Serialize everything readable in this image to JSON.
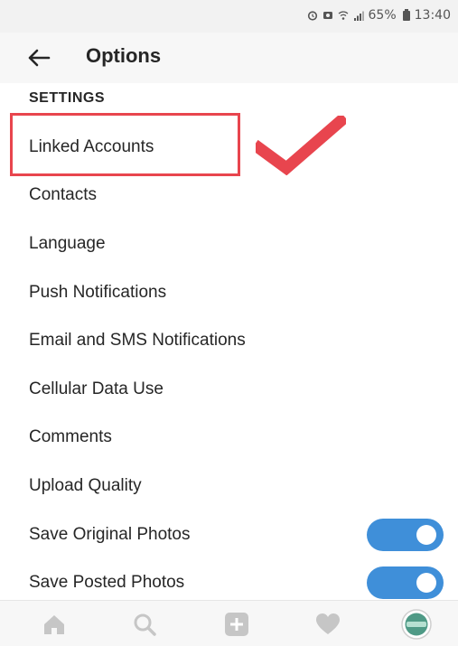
{
  "status_bar": {
    "battery": "65%",
    "time": "13:40",
    "icons": [
      "alarm-icon",
      "notification-icon",
      "wifi-icon",
      "signal-icon",
      "battery-icon"
    ]
  },
  "header": {
    "title": "Options",
    "back_icon": "arrow-left-icon"
  },
  "section": {
    "title": "SETTINGS"
  },
  "settings": {
    "items": [
      {
        "label": "Linked Accounts"
      },
      {
        "label": "Contacts"
      },
      {
        "label": "Language"
      },
      {
        "label": "Push Notifications"
      },
      {
        "label": "Email and SMS Notifications"
      },
      {
        "label": "Cellular Data Use"
      },
      {
        "label": "Comments"
      },
      {
        "label": "Upload Quality"
      },
      {
        "label": "Save Original Photos",
        "toggle": true
      },
      {
        "label": "Save Posted Photos",
        "toggle": true
      }
    ]
  },
  "annotation": {
    "highlighted_item": "Linked Accounts",
    "box_color": "#e8454e",
    "check_color": "#e8454e"
  },
  "bottom_nav": {
    "items": [
      "home-icon",
      "search-icon",
      "add-icon",
      "heart-icon",
      "profile-avatar-icon"
    ]
  },
  "colors": {
    "toggle_on": "#3f8fd9",
    "nav_icon": "#c6c6c6",
    "text": "#262626"
  }
}
